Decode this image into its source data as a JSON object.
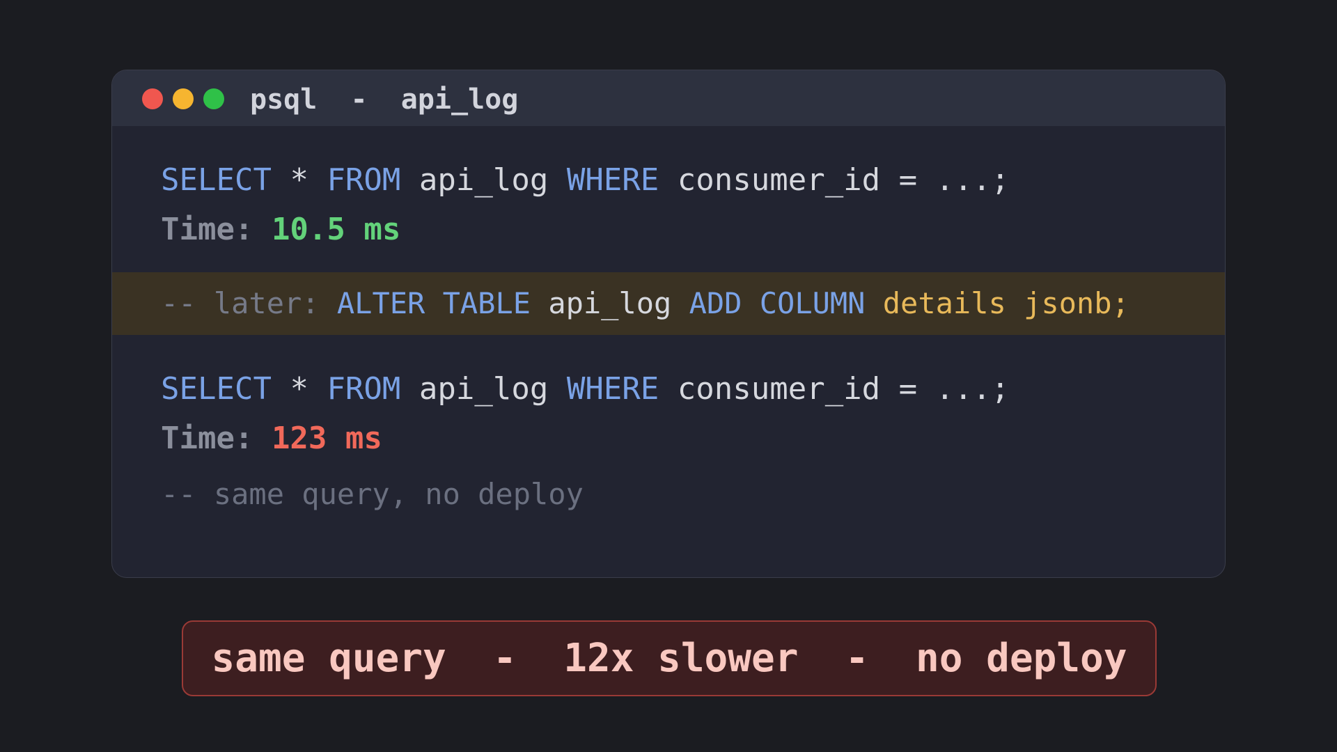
{
  "window": {
    "title": "psql  -  api_log",
    "controls": {
      "close_color": "#f0574f",
      "minimize_color": "#f6b530",
      "maximize_color": "#2fc148"
    }
  },
  "query1": {
    "select": "SELECT",
    "star": " * ",
    "from": "FROM",
    "table": " api_log ",
    "where": "WHERE",
    "condition": " consumer_id = ...;",
    "time_label": "Time:",
    "time_value": " 10.5 ms"
  },
  "migration": {
    "comment": "-- later: ",
    "alter": "ALTER TABLE",
    "table": " api_log ",
    "add": "ADD COLUMN",
    "column": " details jsonb;"
  },
  "query2": {
    "select": "SELECT",
    "star": " * ",
    "from": "FROM",
    "table": " api_log ",
    "where": "WHERE",
    "condition": " consumer_id = ...;",
    "time_label": "Time:",
    "time_value": " 123 ms",
    "comment": "-- same query, no deploy"
  },
  "callout": {
    "text": "same query  -  12x slower  -  no deploy"
  }
}
